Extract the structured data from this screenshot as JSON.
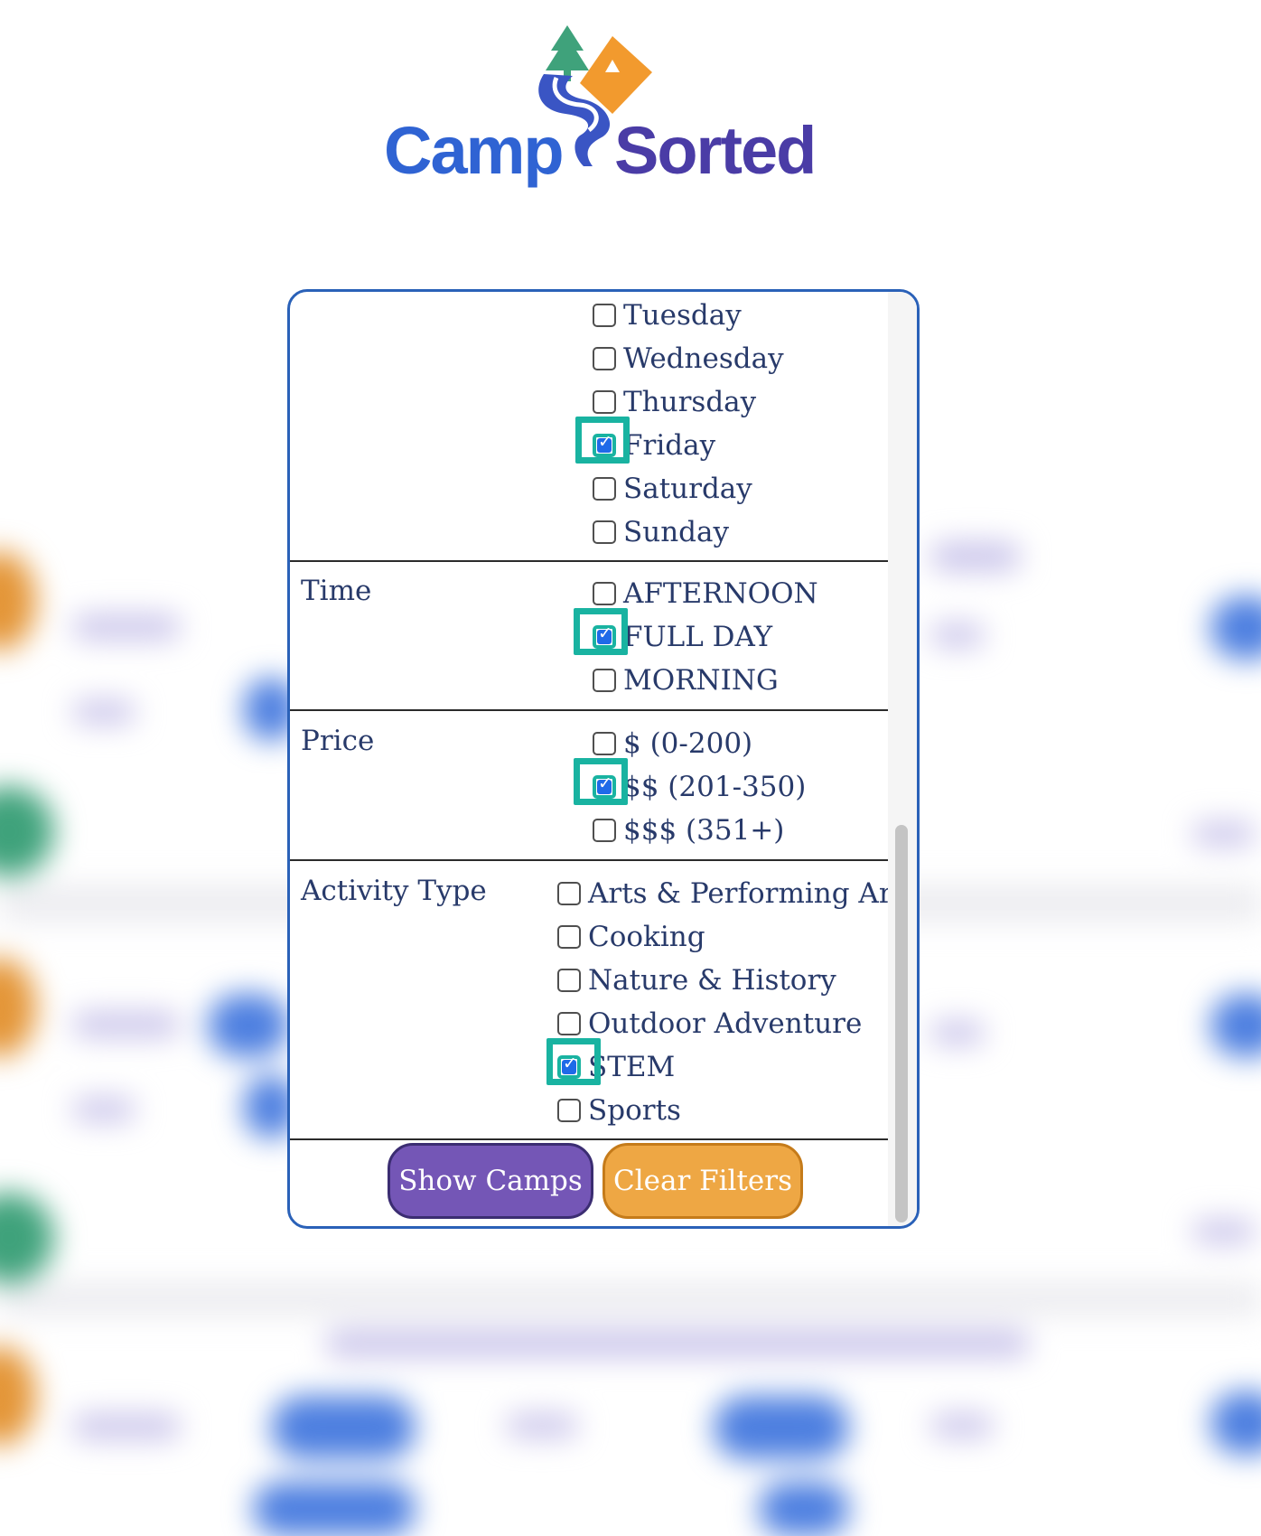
{
  "brand": {
    "name_part1": "Camp",
    "name_part2": "Sorted",
    "colors": {
      "blue": "#2f63d3",
      "indigo": "#4a3ca6",
      "orange": "#f29a2e",
      "green": "#3fa27b"
    }
  },
  "filters": {
    "days": {
      "label": "",
      "options": [
        {
          "label": "Tuesday",
          "checked": false
        },
        {
          "label": "Wednesday",
          "checked": false
        },
        {
          "label": "Thursday",
          "checked": false
        },
        {
          "label": "Friday",
          "checked": true
        },
        {
          "label": "Saturday",
          "checked": false
        },
        {
          "label": "Sunday",
          "checked": false
        }
      ]
    },
    "time": {
      "label": "Time",
      "options": [
        {
          "label": "AFTERNOON",
          "checked": false
        },
        {
          "label": "FULL DAY",
          "checked": true
        },
        {
          "label": "MORNING",
          "checked": false
        }
      ]
    },
    "price": {
      "label": "Price",
      "options": [
        {
          "label": "$ (0-200)",
          "checked": false
        },
        {
          "label": "$$ (201-350)",
          "checked": true
        },
        {
          "label": "$$$ (351+)",
          "checked": false
        }
      ]
    },
    "activity": {
      "label": "Activity Type",
      "options": [
        {
          "label": "Arts & Performing Arts",
          "checked": false
        },
        {
          "label": "Cooking",
          "checked": false
        },
        {
          "label": "Nature & History",
          "checked": false
        },
        {
          "label": "Outdoor Adventure",
          "checked": false
        },
        {
          "label": "STEM",
          "checked": true
        },
        {
          "label": "Sports",
          "checked": false
        }
      ]
    }
  },
  "buttons": {
    "show": "Show Camps",
    "clear": "Clear Filters"
  },
  "theme": {
    "panel_border": "#2a61b8",
    "highlight": "#19b3a1",
    "checkbox_checked": "#1f6ae8",
    "show_button": "#7456b6",
    "clear_button": "#eea744",
    "text": "#283a6a"
  }
}
